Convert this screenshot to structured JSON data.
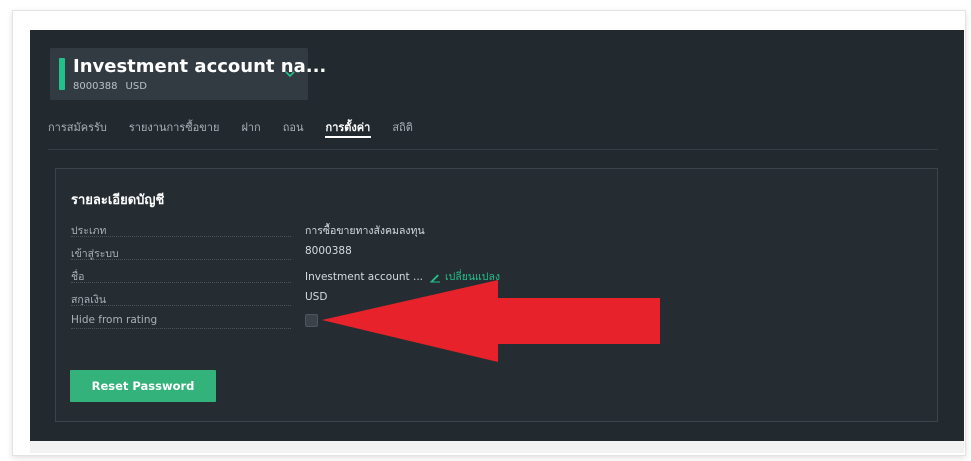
{
  "account": {
    "name": "Investment account na...",
    "number": "8000388",
    "currency": "USD"
  },
  "tabs": [
    {
      "label": "การสมัครรับ",
      "active": false
    },
    {
      "label": "รายงานการซื้อขาย",
      "active": false
    },
    {
      "label": "ฝาก",
      "active": false
    },
    {
      "label": "ถอน",
      "active": false
    },
    {
      "label": "การตั้งค่า",
      "active": true
    },
    {
      "label": "สถิติ",
      "active": false
    }
  ],
  "details": {
    "title": "รายละเอียดบัญชี",
    "rows": [
      {
        "label": "ประเภท",
        "value": "การซื้อขายทางสังคมลงทุน"
      },
      {
        "label": "เข้าสู่ระบบ",
        "value": "8000388"
      },
      {
        "label": "ชื่อ",
        "value": "Investment account ...",
        "action": "เปลี่ยนแปลง"
      },
      {
        "label": "สกุลเงิน",
        "value": "USD"
      },
      {
        "label": "Hide from rating",
        "checked": false
      }
    ],
    "reset_label": "Reset Password"
  },
  "colors": {
    "background": "#232a2f",
    "accent": "#22c08a",
    "button": "#33b27b",
    "annotation_arrow": "#e8222b"
  },
  "icons": {
    "account_dropdown": "chevron-down-icon",
    "edit": "pencil-icon",
    "annotation": "red-arrow"
  }
}
